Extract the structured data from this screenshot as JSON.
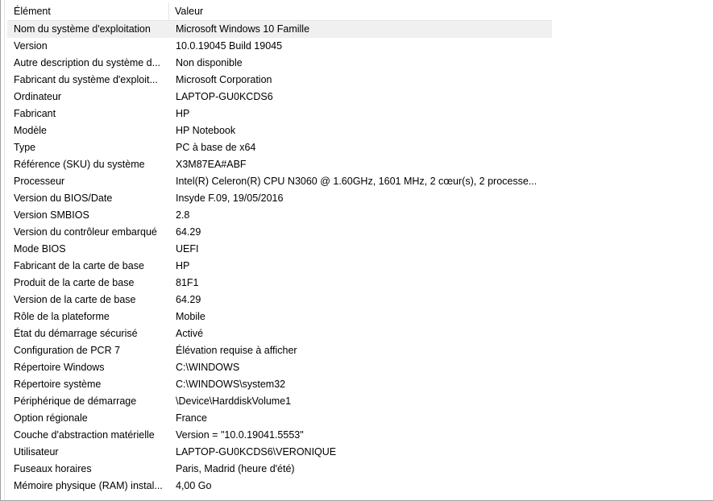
{
  "columns": {
    "element": "Élément",
    "value": "Valeur"
  },
  "rows": [
    {
      "element": "Nom du système d'exploitation",
      "value": "Microsoft Windows 10 Famille"
    },
    {
      "element": "Version",
      "value": "10.0.19045 Build 19045"
    },
    {
      "element": "Autre description du système d...",
      "value": "Non disponible"
    },
    {
      "element": "Fabricant du système d'exploit...",
      "value": "Microsoft Corporation"
    },
    {
      "element": "Ordinateur",
      "value": "LAPTOP-GU0KCDS6"
    },
    {
      "element": "Fabricant",
      "value": "HP"
    },
    {
      "element": "Modèle",
      "value": "HP Notebook"
    },
    {
      "element": "Type",
      "value": "PC à base de x64"
    },
    {
      "element": "Référence (SKU) du système",
      "value": "X3M87EA#ABF"
    },
    {
      "element": "Processeur",
      "value": "Intel(R) Celeron(R) CPU  N3060  @ 1.60GHz, 1601 MHz, 2 cœur(s), 2 processe..."
    },
    {
      "element": "Version du BIOS/Date",
      "value": "Insyde F.09, 19/05/2016"
    },
    {
      "element": "Version SMBIOS",
      "value": "2.8"
    },
    {
      "element": "Version du contrôleur embarqué",
      "value": "64.29"
    },
    {
      "element": "Mode BIOS",
      "value": "UEFI"
    },
    {
      "element": "Fabricant de la carte de base",
      "value": "HP"
    },
    {
      "element": "Produit de la carte de base",
      "value": "81F1"
    },
    {
      "element": "Version de la carte de base",
      "value": "64.29"
    },
    {
      "element": "Rôle de la plateforme",
      "value": "Mobile"
    },
    {
      "element": "État du démarrage sécurisé",
      "value": "Activé"
    },
    {
      "element": "Configuration de PCR 7",
      "value": "Élévation requise à afficher"
    },
    {
      "element": "Répertoire Windows",
      "value": "C:\\WINDOWS"
    },
    {
      "element": "Répertoire système",
      "value": "C:\\WINDOWS\\system32"
    },
    {
      "element": "Périphérique de démarrage",
      "value": "\\Device\\HarddiskVolume1"
    },
    {
      "element": "Option régionale",
      "value": "France"
    },
    {
      "element": "Couche d'abstraction matérielle",
      "value": "Version = \"10.0.19041.5553\""
    },
    {
      "element": "Utilisateur",
      "value": "LAPTOP-GU0KCDS6\\VERONIQUE"
    },
    {
      "element": "Fuseaux horaires",
      "value": "Paris, Madrid (heure d'été)"
    },
    {
      "element": "Mémoire physique (RAM) instal...",
      "value": "4,00 Go"
    }
  ]
}
